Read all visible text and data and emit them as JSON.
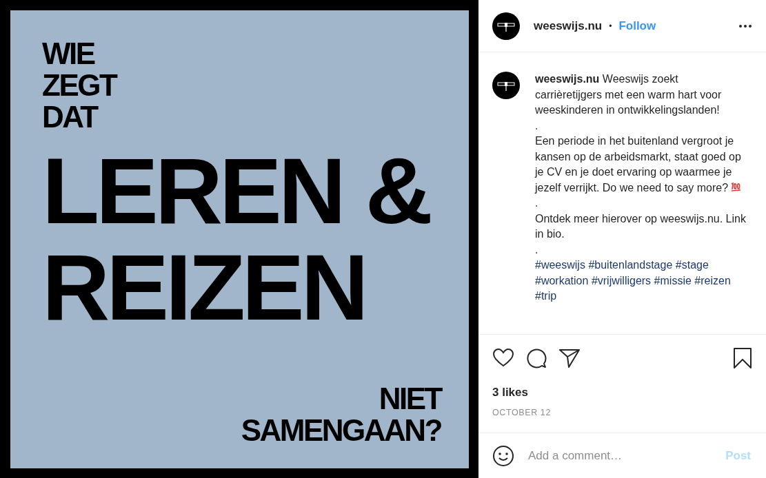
{
  "post_image": {
    "top_text": [
      "WIE",
      "ZEGT",
      "DAT"
    ],
    "headline": [
      "LEREN &",
      "REIZEN"
    ],
    "bottom_text": [
      "NIET",
      "SAMENGAAN?"
    ]
  },
  "header": {
    "username": "weeswijs.nu",
    "separator": "•",
    "follow": "Follow"
  },
  "caption": {
    "username": "weeswijs.nu",
    "paragraphs": [
      {
        "text": "Weeswijs zoekt carrièretijgers met een warm hart voor weeskinderen in ontwikkelingslanden!",
        "hundred_icon": false
      },
      {
        "text": ".",
        "hundred_icon": false
      },
      {
        "text": "Een periode in het buitenland vergroot je kansen op de arbeidsmarkt, staat goed op je CV en je doet ervaring op waarmee je jezelf verrijkt. Do we need to say more?",
        "hundred_icon": true
      },
      {
        "text": ".",
        "hundred_icon": false
      },
      {
        "text": "Ontdek meer hierover op weeswijs.nu. Link in bio.",
        "hundred_icon": false
      },
      {
        "text": ".",
        "hundred_icon": false
      }
    ],
    "hashtags": [
      "#weeswijs",
      "#buitenlandstage",
      "#stage",
      "#workation",
      "#vrijwilligers",
      "#missie",
      "#reizen",
      "#trip"
    ]
  },
  "likes": "3 likes",
  "date": "OCTOBER 12",
  "comment": {
    "placeholder": "Add a comment…",
    "post": "Post",
    "post_disabled": true
  }
}
